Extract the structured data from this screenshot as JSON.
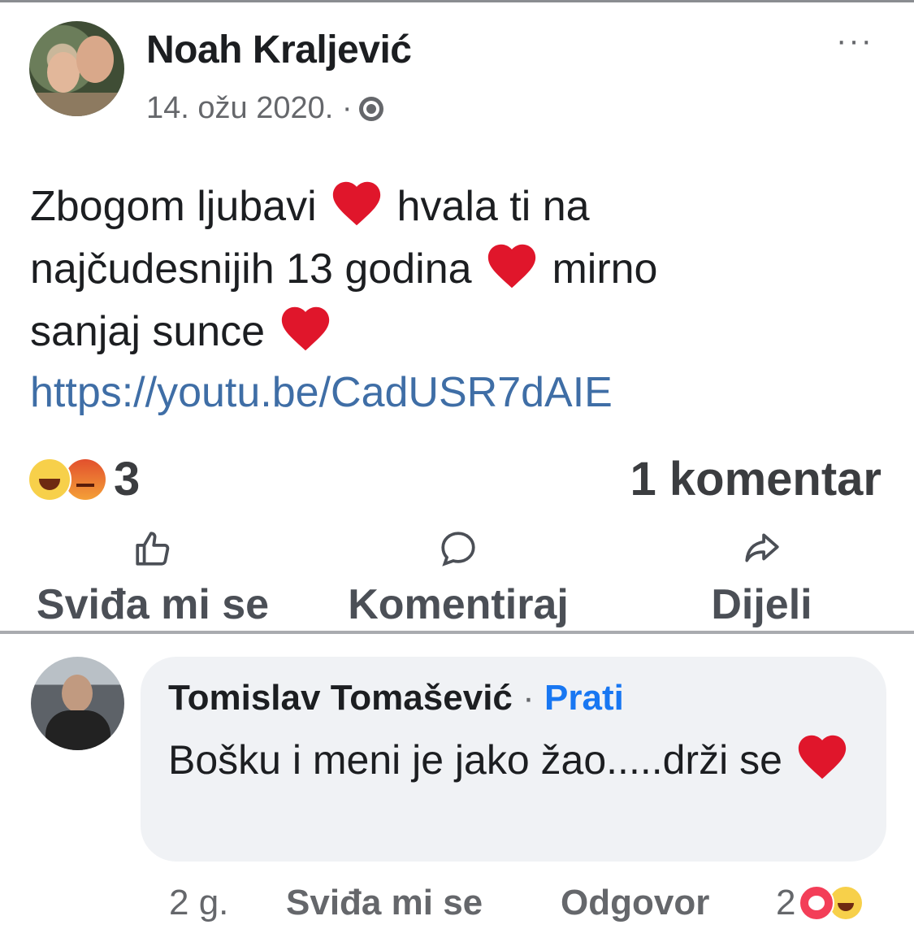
{
  "post": {
    "author": "Noah Kraljević",
    "date": "14. ožu 2020. ·",
    "text_line1": "Zbogom ljubavi",
    "text_line1b": "hvala ti na",
    "text_line2": "najčudesnijih 13 godina",
    "text_line2b": "mirno",
    "text_line3": "sanjaj sunce",
    "link": "https://youtu.be/CadUSR7dAIE",
    "reaction_count": "3",
    "comment_count": "1 komentar",
    "more_icon": "···"
  },
  "actions": {
    "like_label": "Sviđa mi se",
    "comment_label": "Komentiraj",
    "share_label": "Dijeli"
  },
  "comment": {
    "author": "Tomislav Tomašević",
    "separator": "·",
    "follow_label": "Prati",
    "text": "Bošku i meni je jako žao.....drži se",
    "time": "2 g.",
    "like_label": "Sviđa mi se",
    "reply_label": "Odgovor",
    "reaction_count": "2"
  },
  "colors": {
    "link": "#3f6ea6",
    "follow": "#1877f2",
    "heart": "#e0162b",
    "secondary_text": "#65676b"
  }
}
